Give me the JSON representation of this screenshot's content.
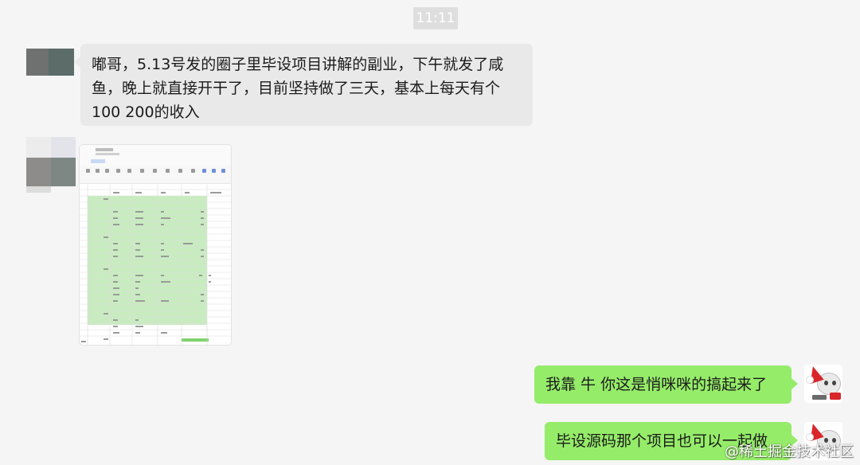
{
  "chat": {
    "timestamp": "11:11",
    "messages": [
      {
        "side": "left",
        "type": "text",
        "lines": [
          "嘟哥，5.13号发的圈子里毕设项目讲解的副业，下午就发了咸",
          "鱼，晚上就直接开干了，目前坚持做了三天，基本上每天有个",
          "100 200的收入"
        ]
      },
      {
        "side": "left",
        "type": "image",
        "image_kind": "spreadsheet-screenshot"
      },
      {
        "side": "right",
        "type": "text",
        "text": "我靠 牛 你这是悄咪咪的搞起来了"
      },
      {
        "side": "right",
        "type": "text",
        "text": "毕设源码那个项目也可以一起做"
      }
    ]
  },
  "watermark": "@稀土掘金技术社区",
  "colors": {
    "background": "#f5f5f5",
    "left_bubble": "#e9e9e9",
    "right_bubble": "#95ec69",
    "time_badge": "#dedede",
    "sheet_highlight": "#c8ecc0"
  },
  "icons": {
    "contact_avatar": "pixelated-avatar-icon",
    "my_avatar": "cartoon-santa-hat-avatar-icon"
  }
}
